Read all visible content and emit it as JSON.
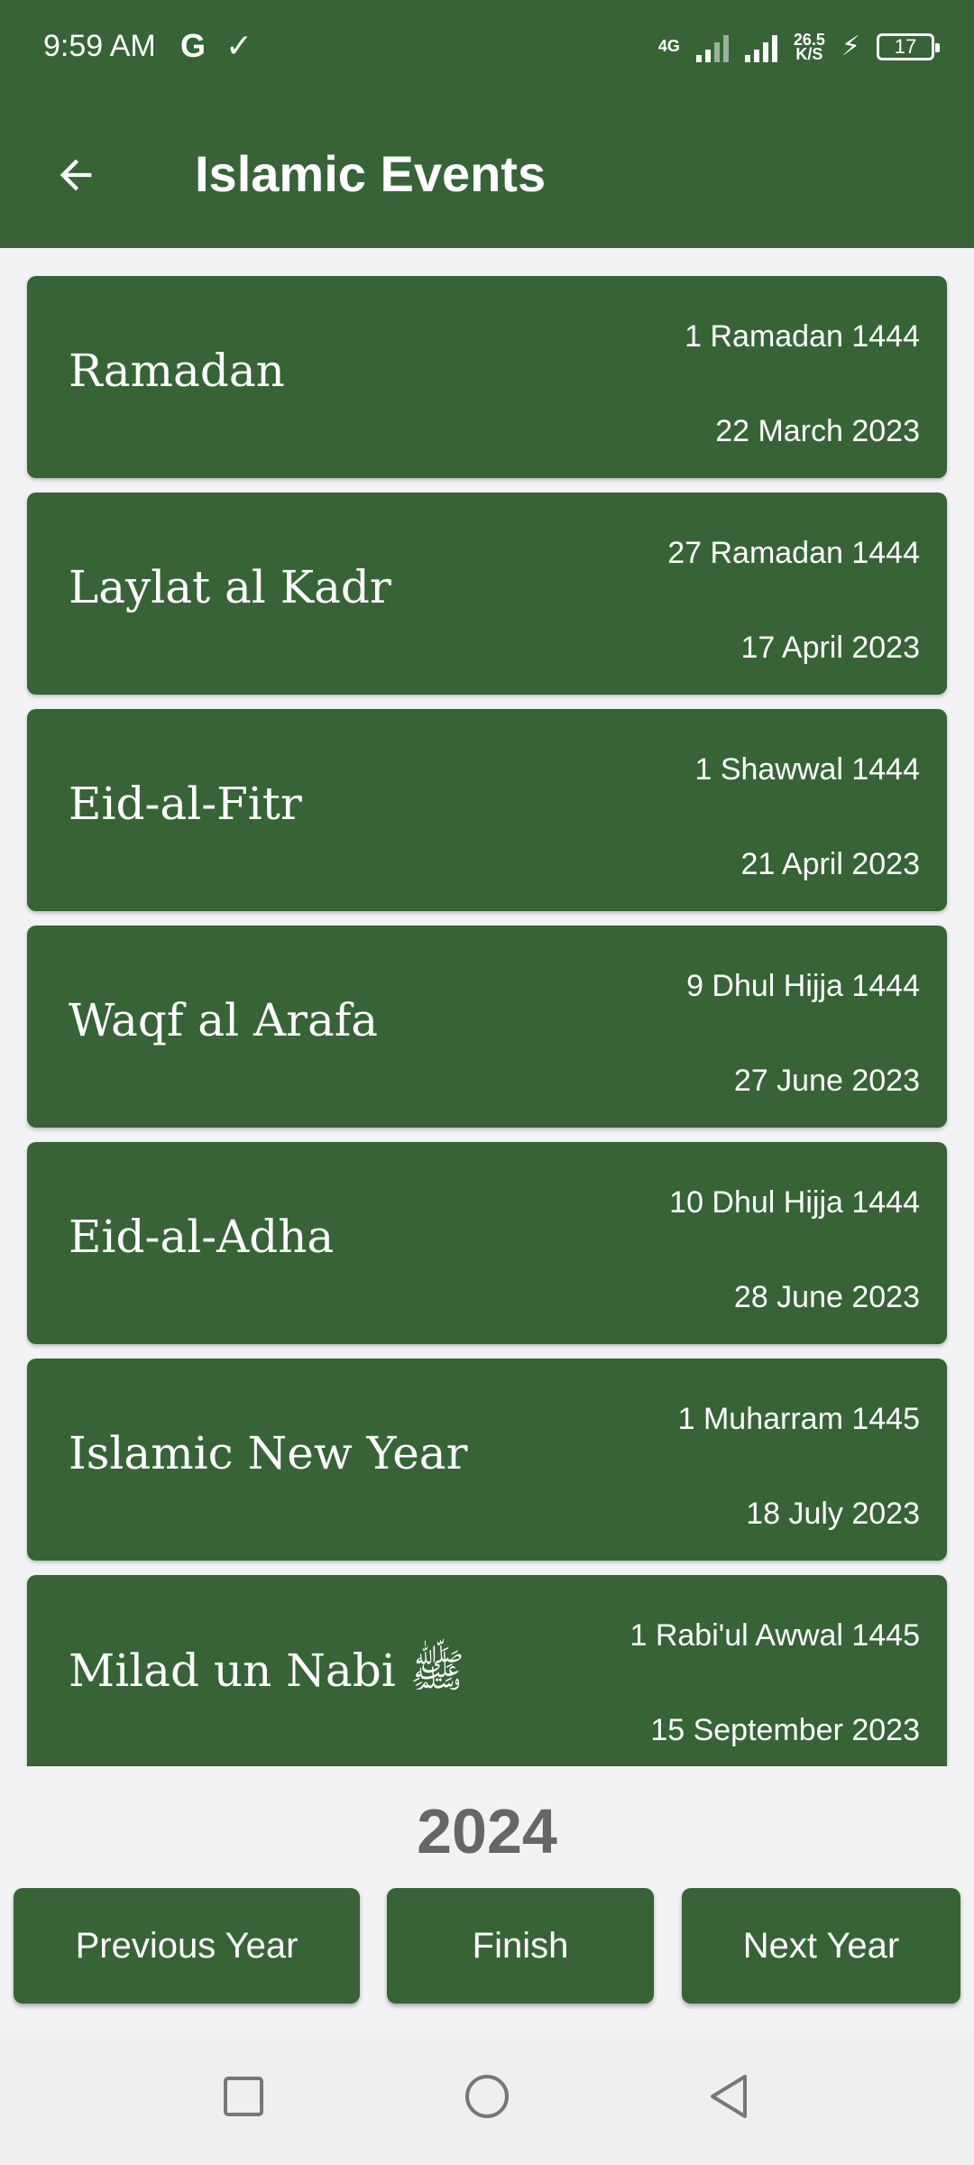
{
  "status_bar": {
    "time": "9:59 AM",
    "app_icons": [
      "G",
      "✓"
    ],
    "network_type": "4G",
    "net_speed_value": "26.5",
    "net_speed_unit": "K/S",
    "battery_level": "17"
  },
  "app_bar": {
    "title": "Islamic Events",
    "back_icon": "arrow-left-icon"
  },
  "events": [
    {
      "name": "Ramadan",
      "hijri": "1 Ramadan 1444",
      "gregorian": "22 March 2023"
    },
    {
      "name": "Laylat al Kadr",
      "hijri": "27 Ramadan 1444",
      "gregorian": "17 April 2023"
    },
    {
      "name": "Eid-al-Fitr",
      "hijri": "1 Shawwal 1444",
      "gregorian": "21 April 2023"
    },
    {
      "name": "Waqf al Arafa",
      "hijri": "9 Dhul Hijja 1444",
      "gregorian": "27 June 2023"
    },
    {
      "name": "Eid-al-Adha",
      "hijri": "10 Dhul Hijja 1444",
      "gregorian": "28 June 2023"
    },
    {
      "name": "Islamic New Year",
      "hijri": "1 Muharram 1445",
      "gregorian": "18 July 2023"
    },
    {
      "name": "Milad un Nabi ﷺ",
      "hijri": "1 Rabi'ul Awwal 1445",
      "gregorian": "15 September 2023"
    }
  ],
  "year": "2024",
  "buttons": {
    "previous": "Previous Year",
    "finish": "Finish",
    "next": "Next Year"
  },
  "nav_bar": {
    "recents_icon": "square-icon",
    "home_icon": "circle-icon",
    "back_icon": "triangle-back-icon"
  },
  "colors": {
    "primary": "#376337",
    "background": "#f3f3f5",
    "year_text": "#666666",
    "nav_bar": "#efefef"
  }
}
